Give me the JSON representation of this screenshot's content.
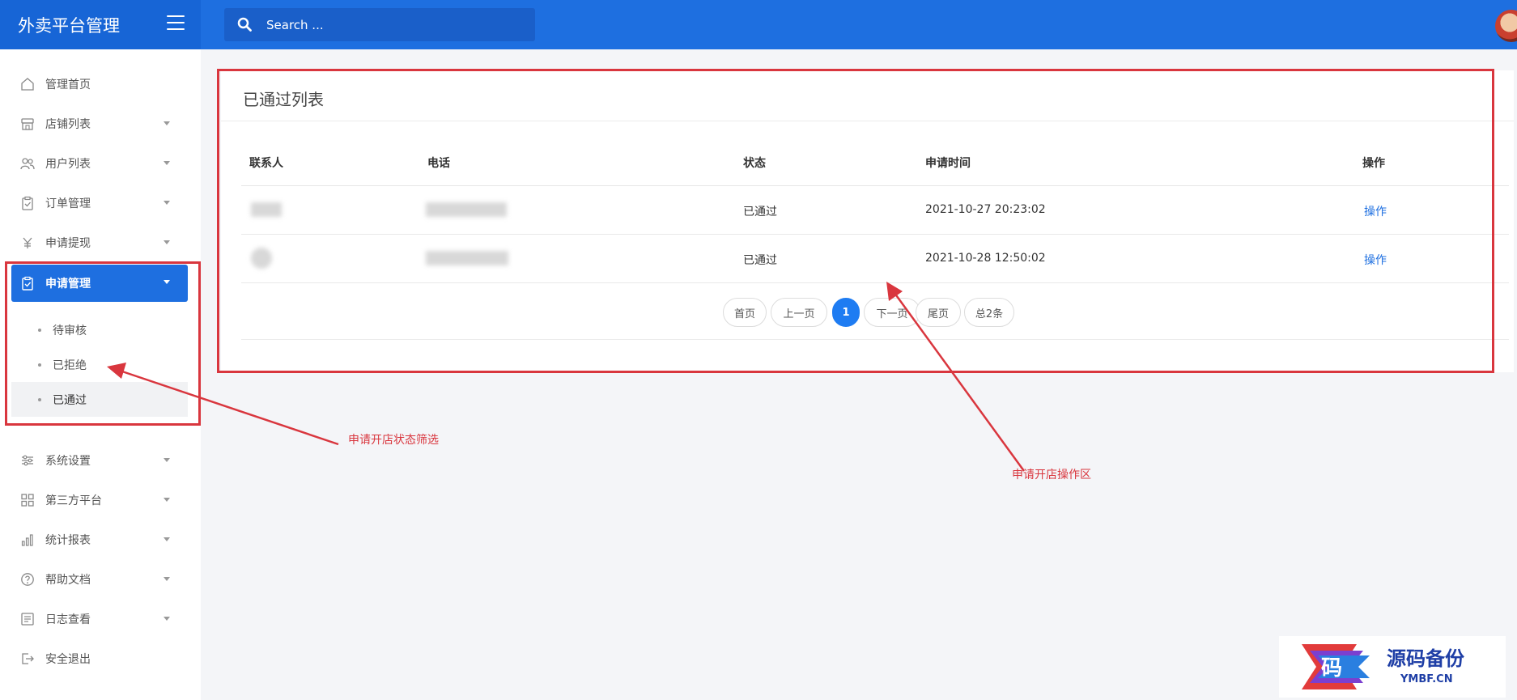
{
  "header": {
    "brand": "外卖平台管理",
    "search_placeholder": "Search ..."
  },
  "sidebar": {
    "items": [
      {
        "label": "管理首页",
        "icon": "home-icon",
        "has_caret": false
      },
      {
        "label": "店铺列表",
        "icon": "store-icon",
        "has_caret": true
      },
      {
        "label": "用户列表",
        "icon": "users-icon",
        "has_caret": true
      },
      {
        "label": "订单管理",
        "icon": "clipboard-icon",
        "has_caret": true
      },
      {
        "label": "申请提现",
        "icon": "yen-icon",
        "has_caret": true
      },
      {
        "label": "申请管理",
        "icon": "clipboard-check-icon",
        "has_caret": true,
        "active": true
      },
      {
        "label": "系统设置",
        "icon": "sliders-icon",
        "has_caret": true
      },
      {
        "label": "第三方平台",
        "icon": "grid-icon",
        "has_caret": true
      },
      {
        "label": "统计报表",
        "icon": "bar-chart-icon",
        "has_caret": true
      },
      {
        "label": "帮助文档",
        "icon": "help-icon",
        "has_caret": true
      },
      {
        "label": "日志查看",
        "icon": "log-icon",
        "has_caret": true
      },
      {
        "label": "安全退出",
        "icon": "logout-icon",
        "has_caret": false
      }
    ],
    "submenu": [
      {
        "label": "待审核"
      },
      {
        "label": "已拒绝"
      },
      {
        "label": "已通过",
        "selected": true
      }
    ]
  },
  "main": {
    "title": "已通过列表",
    "columns": [
      "联系人",
      "电话",
      "状态",
      "申请时间",
      "操作"
    ],
    "rows": [
      {
        "contact": "",
        "phone": "",
        "status": "已通过",
        "time": "2021-10-27 20:23:02",
        "action": "操作"
      },
      {
        "contact": "",
        "phone": "",
        "status": "已通过",
        "time": "2021-10-28 12:50:02",
        "action": "操作"
      }
    ],
    "pagination": {
      "first": "首页",
      "prev": "上一页",
      "current": "1",
      "next": "下一页",
      "last": "尾页",
      "total": "总2条"
    }
  },
  "annotations": {
    "filter_note": "申请开店状态筛选",
    "action_note": "申请开店操作区",
    "color": "#d9363e"
  },
  "watermark": {
    "glyph": "码",
    "text": "源码备份",
    "sub": "YMBF.CN"
  },
  "colors": {
    "primary": "#1e6fe0",
    "sidebar_bg": "#ffffff",
    "page_bg": "#f4f5f8"
  }
}
